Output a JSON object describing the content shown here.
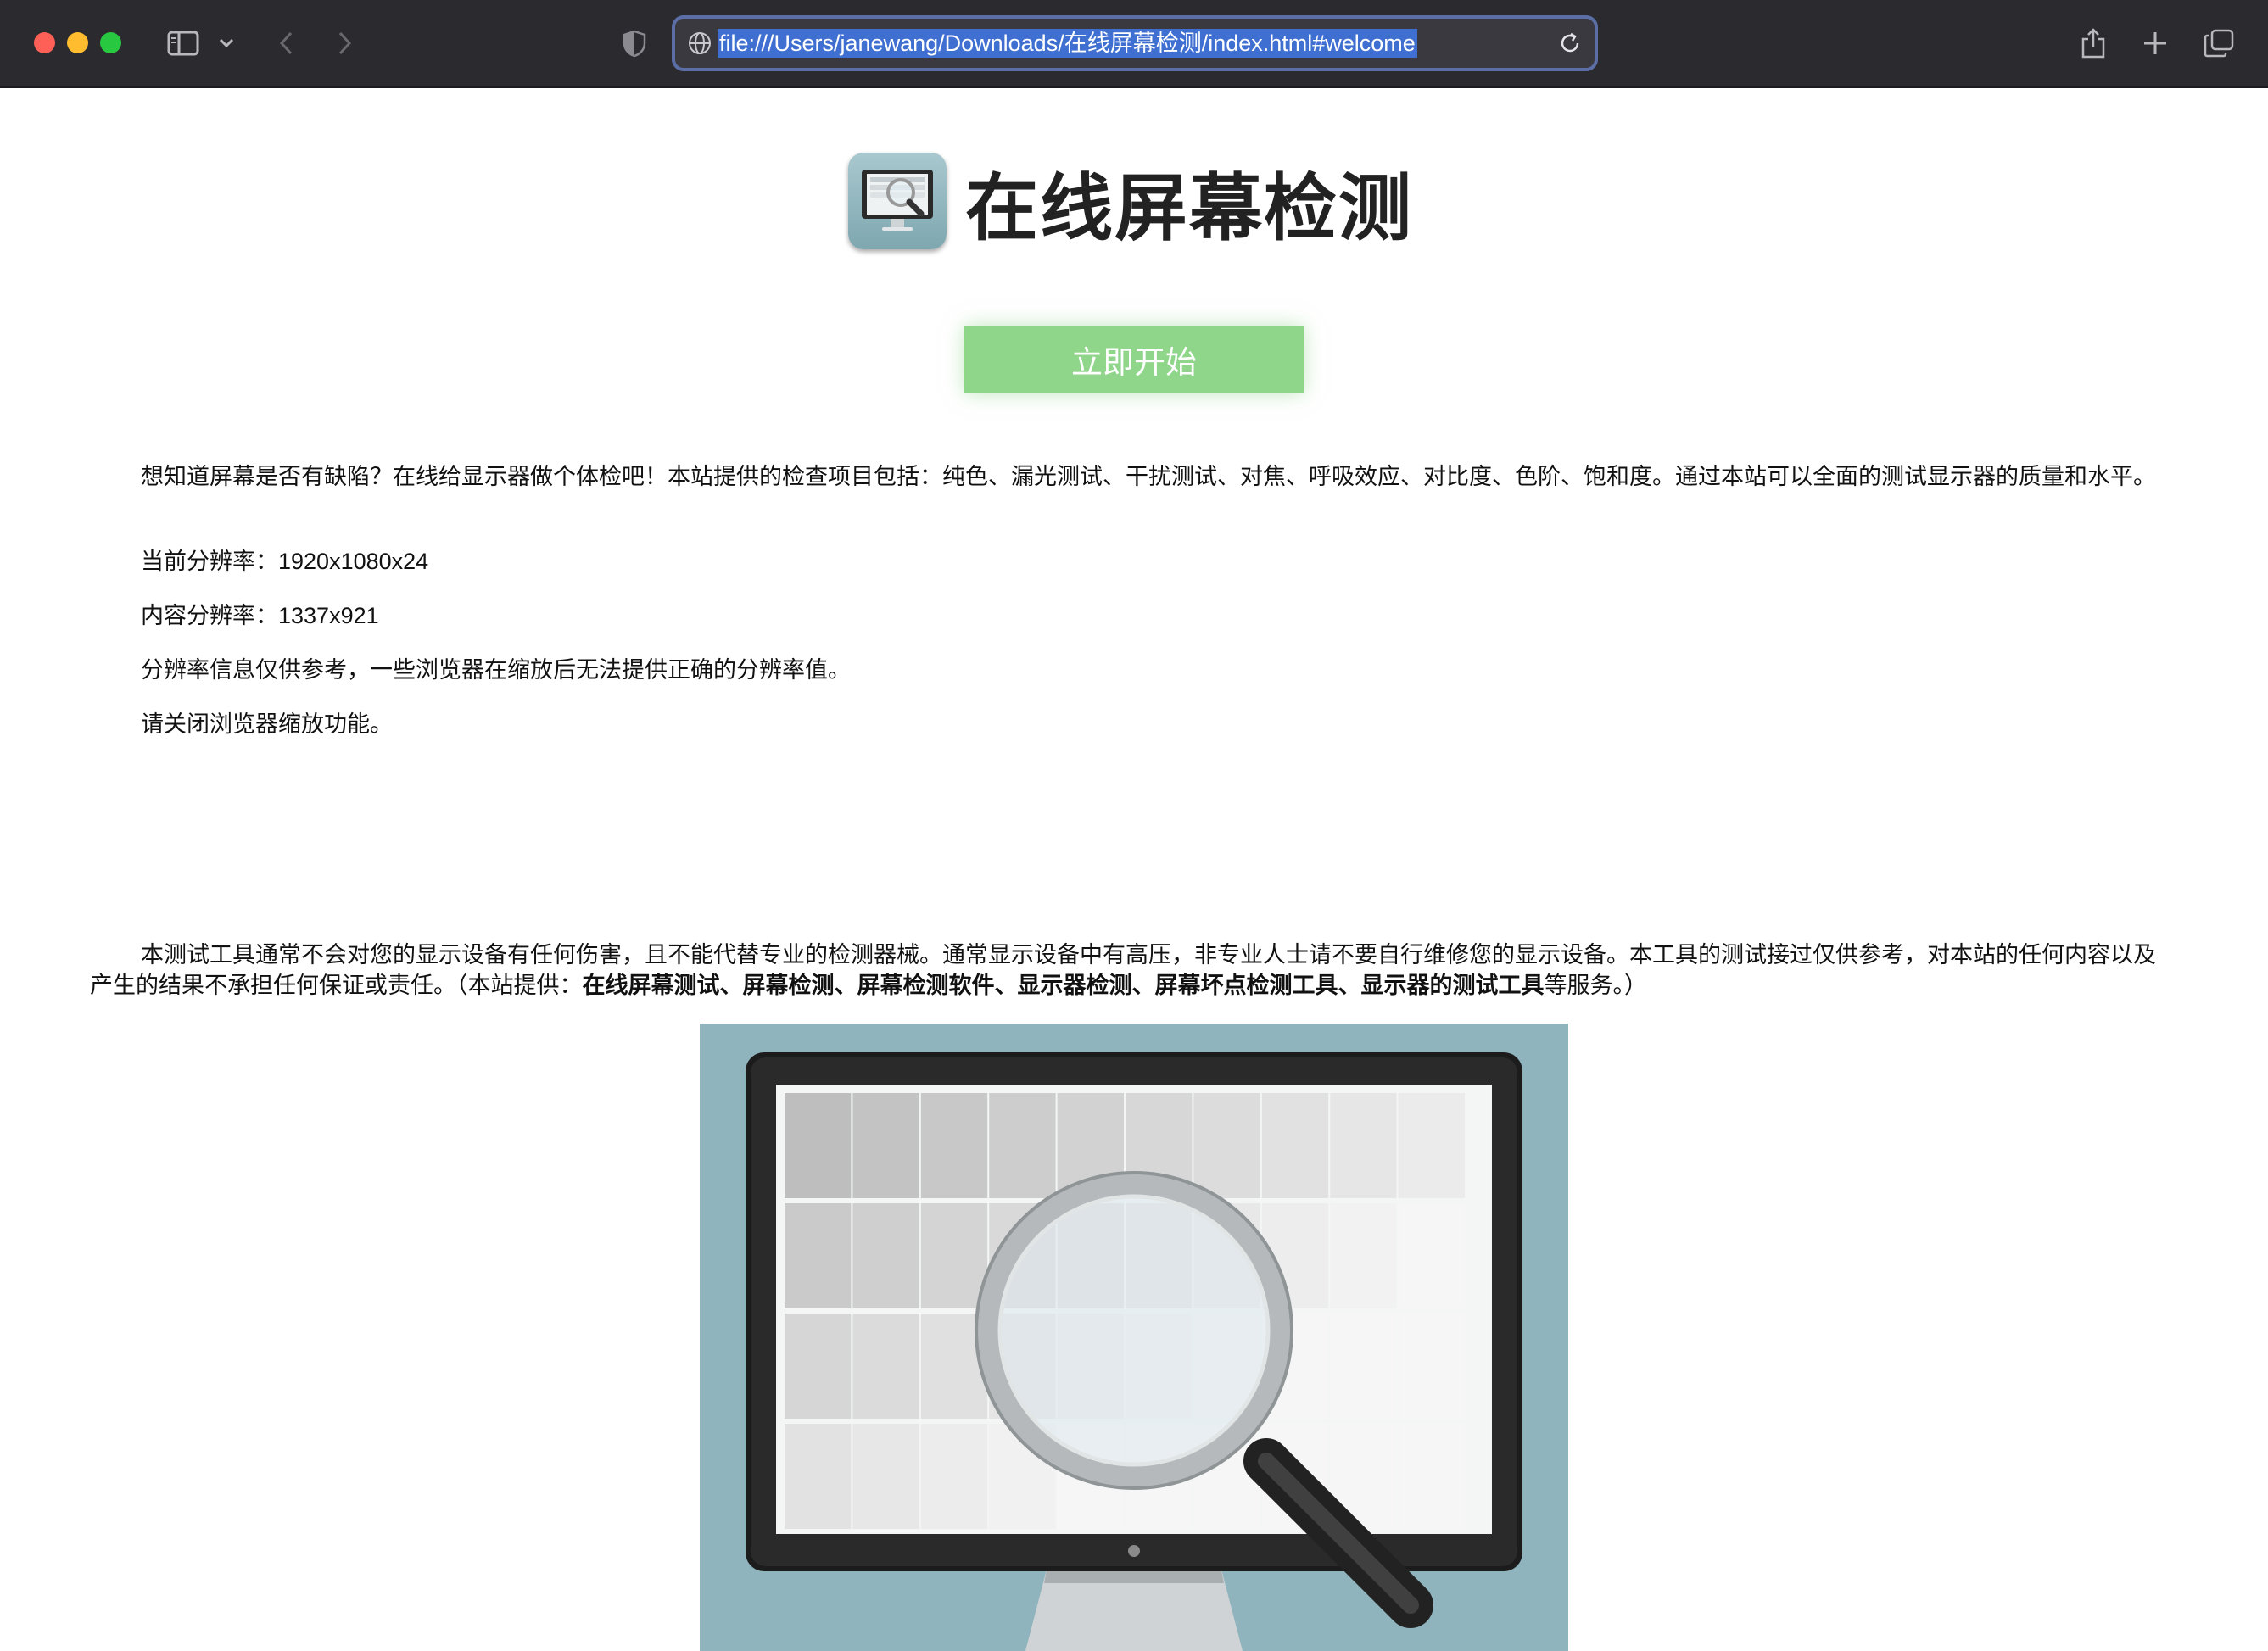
{
  "browser": {
    "url": "file:///Users/janewang/Downloads/在线屏幕检测/index.html#welcome"
  },
  "page": {
    "title": "在线屏幕检测",
    "start_button": "立即开始",
    "intro": "想知道屏幕是否有缺陷？在线给显示器做个体检吧！本站提供的检查项目包括：纯色、漏光测试、干扰测试、对焦、呼吸效应、对比度、色阶、饱和度。通过本站可以全面的测试显示器的质量和水平。",
    "current_resolution_label": "当前分辨率：",
    "current_resolution": "1920x1080x24",
    "content_resolution_label": "内容分辨率：",
    "content_resolution": "1337x921",
    "resolution_note": "分辨率信息仅供参考，一些浏览器在缩放后无法提供正确的分辨率值。",
    "zoom_note": "请关闭浏览器缩放功能。",
    "disclaimer_main": "本测试工具通常不会对您的显示设备有任何伤害，且不能代替专业的检测器械。通常显示设备中有高压，非专业人士请不要自行维修您的显示设备。本工具的测试接过仅供参考，对本站的任何内容以及产生的结果不承担任何保证或责任。（本站提供：",
    "disclaimer_services": "在线屏幕测试、屏幕检测、屏幕检测软件、显示器检测、屏幕坏点检测工具、显示器的测试工具",
    "disclaimer_end": "等服务。）"
  },
  "icons": {
    "sidebar": "sidebar-icon",
    "back": "chevron-left-icon",
    "forward": "chevron-right-icon",
    "privacy": "shield-icon",
    "share": "share-icon",
    "new_tab": "plus-icon",
    "tabs": "tabs-overview-icon"
  },
  "colors": {
    "start_button": "#8fd68a",
    "hero_background": "#8fb4bd",
    "url_selection": "#3f6fd0"
  }
}
